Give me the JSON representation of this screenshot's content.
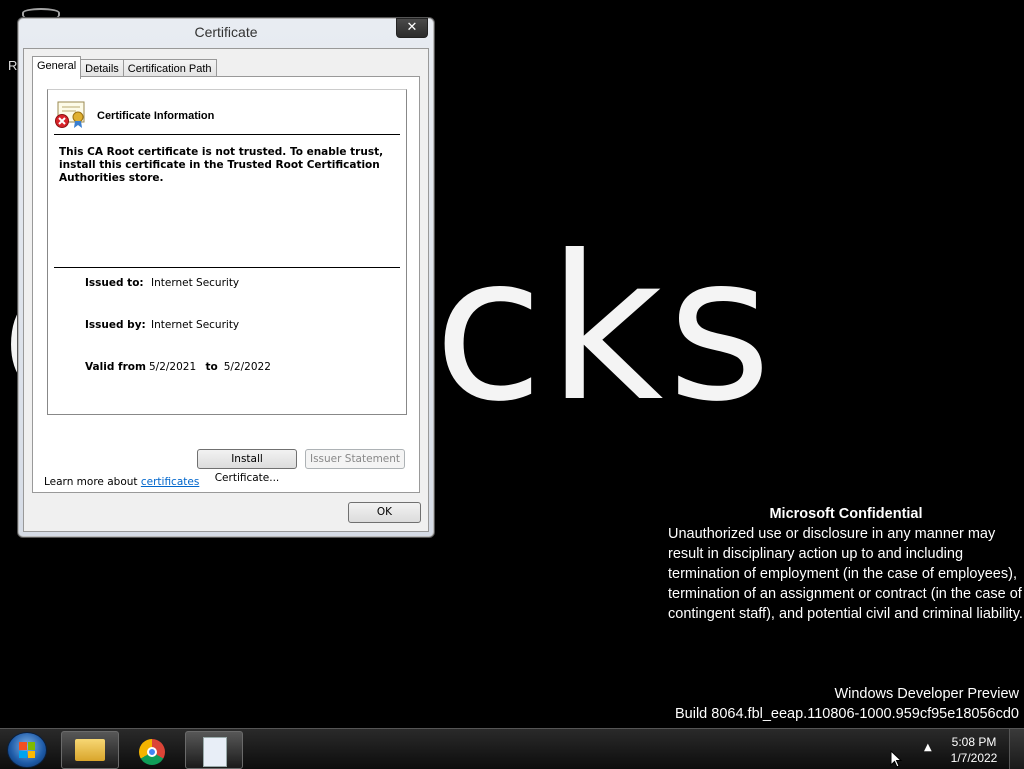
{
  "desktop": {
    "wallpaper_text": "e sucks",
    "icon_letter": "R"
  },
  "watermark": {
    "title": "Microsoft Confidential",
    "body": "Unauthorized use or disclosure in any manner may result in disciplinary action up to and including termination of employment (in the case of employees), termination of an assignment or contract (in the case of contingent staff), and potential civil and criminal liability.",
    "build_line1": "Windows Developer Preview",
    "build_line2": "Build 8064.fbl_eeap.110806-1000.959cf95e18056cd0"
  },
  "dialog": {
    "title": "Certificate",
    "close_glyph": "✕",
    "tabs": [
      "General",
      "Details",
      "Certification Path"
    ],
    "info_title": "Certificate Information",
    "message": "This CA Root certificate is not trusted. To enable trust, install this certificate in the Trusted Root Certification Authorities store.",
    "issued_to_label": "Issued to:",
    "issued_to_value": "Internet Security",
    "issued_by_label": "Issued by:",
    "issued_by_value": "Internet Security",
    "valid_from_label": "Valid from",
    "valid_from_value": "5/2/2021",
    "valid_to_label": "to",
    "valid_to_value": "5/2/2022",
    "install_button": "Install Certificate...",
    "issuer_statement_button": "Issuer Statement",
    "learn_more_text": "Learn more about",
    "learn_more_link": "certificates",
    "ok_button": "OK"
  },
  "taskbar": {
    "items": [
      "start-button",
      "windows-explorer",
      "google-chrome",
      "document"
    ],
    "tray_arrow": "▲",
    "time": "5:08 PM",
    "date": "1/7/2022"
  }
}
